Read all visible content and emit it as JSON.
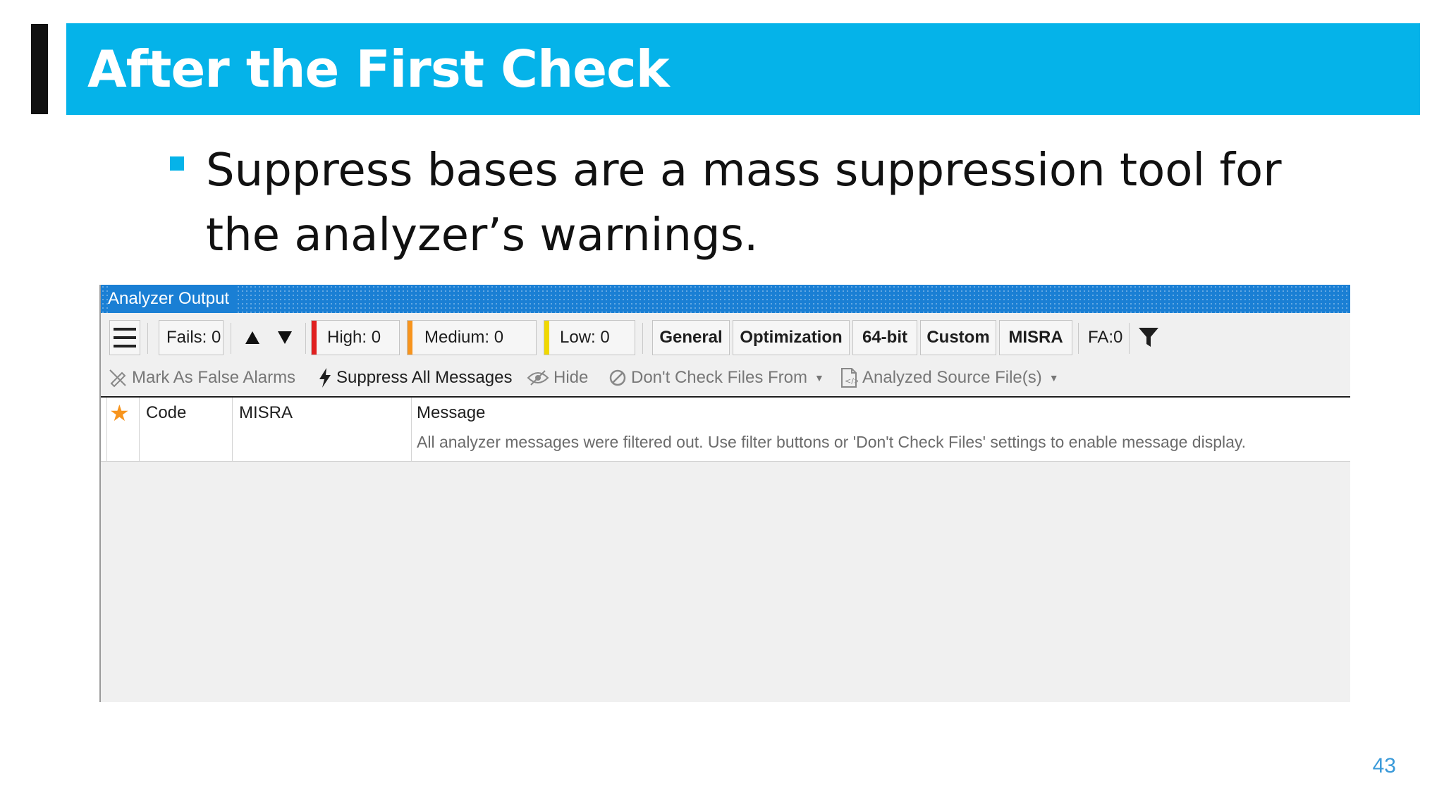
{
  "slide": {
    "title": "After the First Check",
    "bullet": "Suppress bases are a mass suppression tool for the analyzer’s warnings.",
    "page_number": "43",
    "accent_color": "#05b3e9"
  },
  "panel": {
    "title": "Analyzer Output",
    "toolbar": {
      "menu_icon": "hamburger-icon",
      "fails": "Fails: 0",
      "high": "High: 0",
      "medium": "Medium: 0",
      "low": "Low: 0",
      "categories": [
        "General",
        "Optimization",
        "64-bit",
        "Custom",
        "MISRA"
      ],
      "fa": "FA:0",
      "filter_icon": "filter-icon"
    },
    "actions": {
      "mark_false_alarms": "Mark As False Alarms",
      "suppress_all": "Suppress All Messages",
      "hide": "Hide",
      "dont_check": "Don't Check Files From",
      "analyzed_files": "Analyzed Source File(s)"
    },
    "grid": {
      "columns": [
        "Code",
        "MISRA",
        "Message"
      ],
      "empty_message": "All analyzer messages were filtered out. Use filter buttons or 'Don't Check Files' settings to enable message display."
    },
    "severity_colors": {
      "high": "#e02020",
      "medium": "#f7941d",
      "low": "#f0d800"
    }
  }
}
